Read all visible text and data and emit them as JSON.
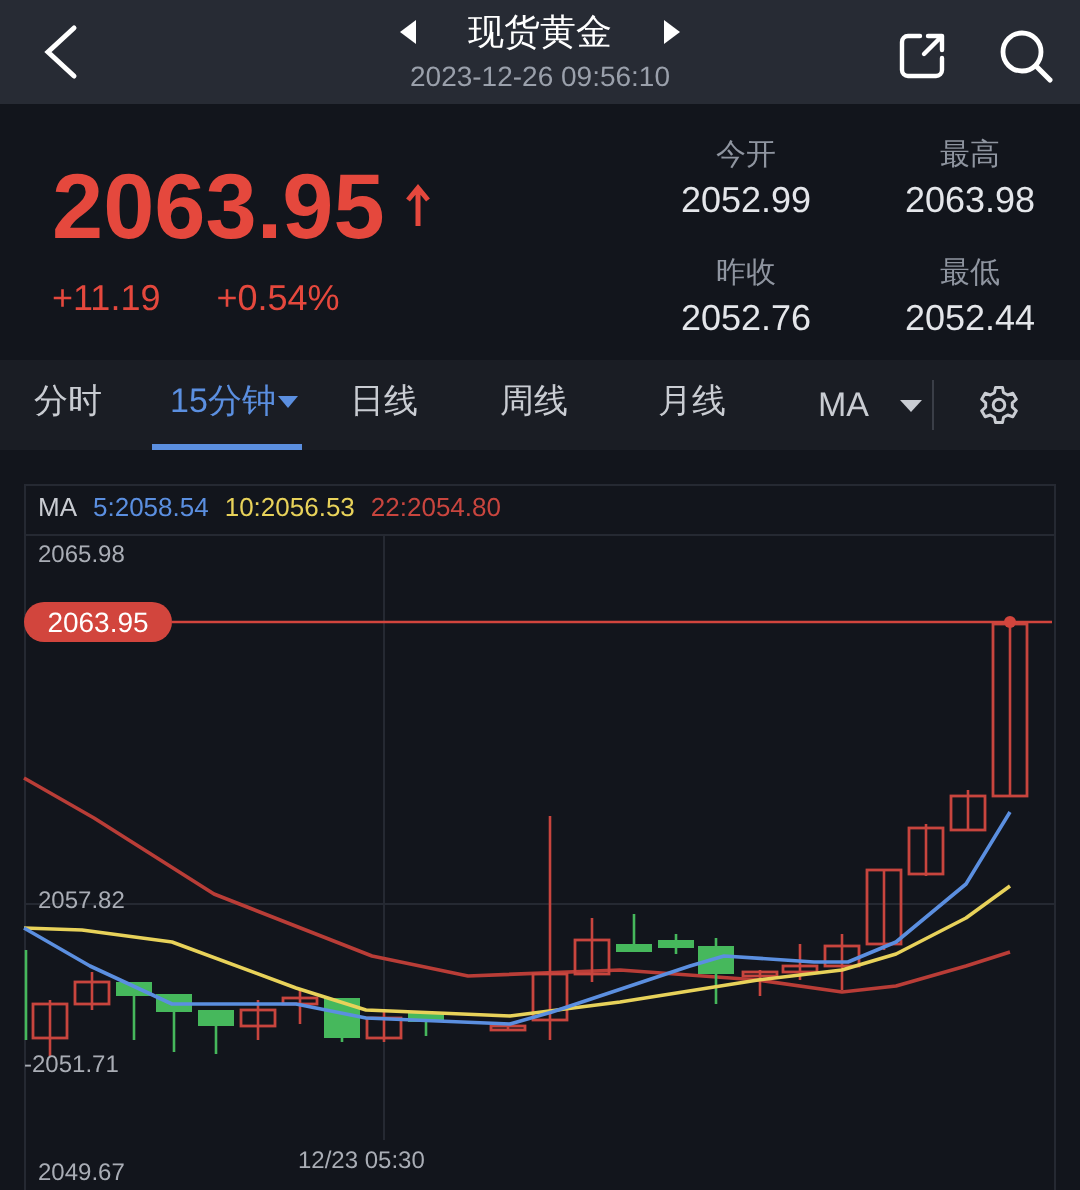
{
  "header": {
    "title": "现货黄金",
    "datetime": "2023-12-26 09:56:10"
  },
  "quote": {
    "price": "2063.95",
    "rising": true,
    "change": "+11.19",
    "change_pct": "+0.54%",
    "stats": [
      {
        "label": "今开",
        "value": "2052.99"
      },
      {
        "label": "最高",
        "value": "2063.98"
      },
      {
        "label": "昨收",
        "value": "2052.76"
      },
      {
        "label": "最低",
        "value": "2052.44"
      }
    ]
  },
  "tabs": [
    {
      "label": "分时",
      "selected": false,
      "dropdown": false
    },
    {
      "label": "15分钟",
      "selected": true,
      "dropdown": true
    },
    {
      "label": "日线",
      "selected": false,
      "dropdown": false
    },
    {
      "label": "周线",
      "selected": false,
      "dropdown": false
    },
    {
      "label": "月线",
      "selected": false,
      "dropdown": false
    }
  ],
  "indicator": {
    "label": "MA",
    "dropdown": true
  },
  "ma_legend": {
    "label": "MA",
    "items": [
      {
        "text": "5:2058.54",
        "color": "#5b8fe0"
      },
      {
        "text": "10:2056.53",
        "color": "#e8d25a"
      },
      {
        "text": "22:2054.80",
        "color": "#c8453e"
      }
    ]
  },
  "chart": {
    "price_labels": [
      "2065.98",
      "2057.82",
      "-2051.71",
      "2049.67"
    ],
    "current_price": "2063.95",
    "time_label": "12/23 05:30"
  }
}
